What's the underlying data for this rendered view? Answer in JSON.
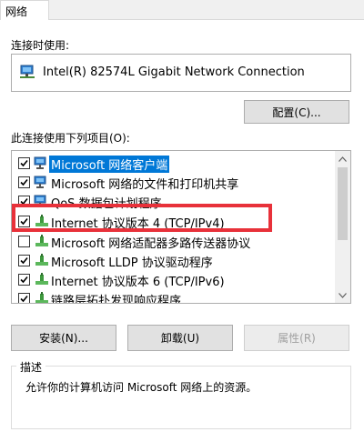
{
  "tab": {
    "label": "网络"
  },
  "connect_using": {
    "label": "连接时使用:",
    "adapter_name": "Intel(R) 82574L Gigabit Network Connection",
    "icon": "network-adapter-icon"
  },
  "configure_button": {
    "label": "配置(C)..."
  },
  "items_section": {
    "label": "此连接使用下列项目(O):",
    "items": [
      {
        "label": "Microsoft 网络客户端",
        "checked": true,
        "icon": "network-client-icon",
        "selected": true
      },
      {
        "label": "Microsoft 网络的文件和打印机共享",
        "checked": true,
        "icon": "network-client-icon",
        "selected": false
      },
      {
        "label": "QoS 数据包计划程序",
        "checked": true,
        "icon": "network-client-icon",
        "selected": false
      },
      {
        "label": "Internet 协议版本 4 (TCP/IPv4)",
        "checked": true,
        "icon": "protocol-icon",
        "selected": false,
        "highlighted": true
      },
      {
        "label": "Microsoft 网络适配器多路传送器协议",
        "checked": false,
        "icon": "protocol-icon",
        "selected": false
      },
      {
        "label": "Microsoft LLDP 协议驱动程序",
        "checked": true,
        "icon": "protocol-icon",
        "selected": false
      },
      {
        "label": "Internet 协议版本 6 (TCP/IPv6)",
        "checked": true,
        "icon": "protocol-icon",
        "selected": false
      },
      {
        "label": "链路层拓扑发现响应程序",
        "checked": true,
        "icon": "protocol-icon",
        "selected": false
      }
    ]
  },
  "buttons": {
    "install": "安装(N)...",
    "uninstall": "卸载(U)",
    "properties": "属性(R)"
  },
  "description": {
    "title": "描述",
    "text": "允许你的计算机访问 Microsoft 网络上的资源。"
  },
  "colors": {
    "selection": "#0078d7",
    "highlight_box": "#e8313a",
    "window_bg": "#ffffff"
  }
}
